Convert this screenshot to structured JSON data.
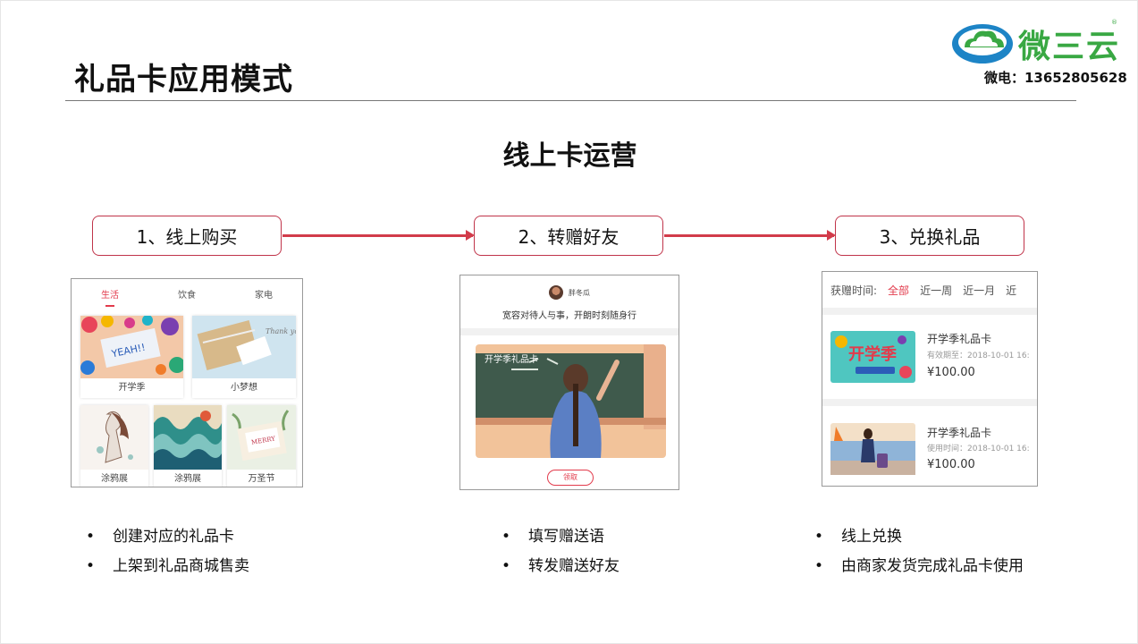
{
  "title": "礼品卡应用模式",
  "logo": {
    "text": "微三云",
    "phone": "微电：13652805628"
  },
  "subtitle": "线上卡运营",
  "steps": [
    "1、线上购买",
    "2、转赠好友",
    "3、兑换礼品"
  ],
  "panel1": {
    "tabs": [
      "生活",
      "饮食",
      "家电"
    ],
    "cards": [
      "开学季",
      "小梦想",
      "涂鸦展",
      "涂鸦展",
      "万圣节"
    ],
    "img_texts": [
      "YEAH!!",
      "Thank you",
      "MERRY"
    ]
  },
  "panel2": {
    "username": "胖冬瓜",
    "message": "宽容对待人与事，开朗时刻随身行",
    "card_label": "开学季礼品卡",
    "button": "领取"
  },
  "panel3": {
    "filter_label": "获赠时间:",
    "filters": [
      "全部",
      "近一周",
      "近一月",
      "近"
    ],
    "items": [
      {
        "name": "开学季礼品卡",
        "date": "有效期至：2018-10-01 16:",
        "price": "¥100.00",
        "art": "开学季"
      },
      {
        "name": "开学季礼品卡",
        "date": "使用时间：2018-10-01 16:",
        "price": "¥100.00",
        "art": ""
      }
    ]
  },
  "bullets": {
    "col1": [
      "创建对应的礼品卡",
      "上架到礼品商城售卖"
    ],
    "col2": [
      "填写赠送语",
      "转发赠送好友"
    ],
    "col3": [
      "线上兑换",
      "由商家发货完成礼品卡使用"
    ]
  }
}
